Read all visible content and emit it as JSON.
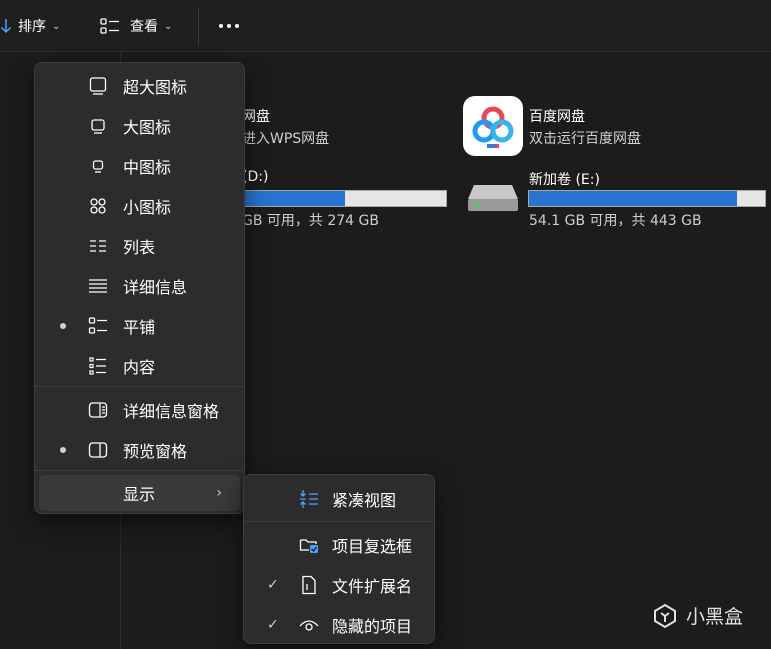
{
  "toolbar": {
    "sort_label": "排序",
    "view_label": "查看",
    "more_label": "更多"
  },
  "content": {
    "wps": {
      "title": "网盘",
      "subtitle": "进入WPS网盘"
    },
    "baidu": {
      "title": "百度网盘",
      "subtitle": "双击运行百度网盘"
    },
    "drive_d": {
      "name": "(D:)",
      "space": "GB 可用，共 274 GB",
      "used_fraction": 0.5
    },
    "drive_e": {
      "name": "新加卷 (E:)",
      "space": "54.1 GB 可用，共 443 GB",
      "used_fraction": 0.88
    }
  },
  "view_menu": {
    "items": [
      {
        "label": "超大图标",
        "icon": "extra-large-icons-icon",
        "selected": false
      },
      {
        "label": "大图标",
        "icon": "large-icons-icon",
        "selected": false
      },
      {
        "label": "中图标",
        "icon": "medium-icons-icon",
        "selected": false
      },
      {
        "label": "小图标",
        "icon": "small-icons-icon",
        "selected": false
      },
      {
        "label": "列表",
        "icon": "list-icon",
        "selected": false
      },
      {
        "label": "详细信息",
        "icon": "details-icon",
        "selected": false
      },
      {
        "label": "平铺",
        "icon": "tiles-icon",
        "selected": true
      },
      {
        "label": "内容",
        "icon": "content-icon",
        "selected": false
      },
      {
        "label": "详细信息窗格",
        "icon": "details-pane-icon",
        "selected": false
      },
      {
        "label": "预览窗格",
        "icon": "preview-pane-icon",
        "selected": true
      },
      {
        "label": "显示",
        "icon": "",
        "selected": false
      }
    ]
  },
  "show_submenu": {
    "items": [
      {
        "label": "紧凑视图",
        "icon": "compact-view-icon",
        "checked": false
      },
      {
        "label": "项目复选框",
        "icon": "item-checkbox-icon",
        "checked": false
      },
      {
        "label": "文件扩展名",
        "icon": "file-extension-icon",
        "checked": true
      },
      {
        "label": "隐藏的项目",
        "icon": "hidden-items-icon",
        "checked": true
      }
    ],
    "check_glyph": "✓"
  },
  "watermark": {
    "text": "小黑盒"
  },
  "colors": {
    "accent": "#2675d0",
    "menu_bg": "#2c2c2c",
    "background": "#1c1c1c"
  }
}
